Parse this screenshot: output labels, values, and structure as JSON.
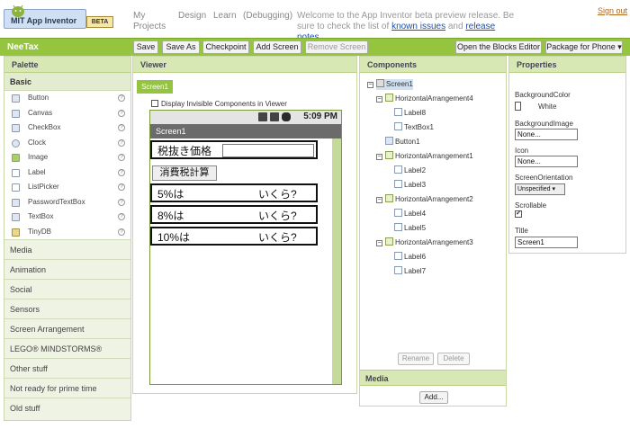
{
  "header": {
    "logo_text": "MIT App Inventor",
    "beta": "BETA",
    "nav": [
      "My Projects",
      "Design",
      "Learn",
      "(Debugging)"
    ],
    "welcome_text": "Welcome to the App Inventor beta preview release. Be sure to check the list of",
    "known_issues": "known issues",
    "and": "and",
    "release_notes": "release notes",
    "period": ".",
    "signout": "Sign out"
  },
  "toolbar": {
    "project_name": "NeeTax",
    "buttons": [
      "Save",
      "Save As",
      "Checkpoint",
      "Add Screen",
      "Remove Screen"
    ],
    "blocks_editor": "Open the Blocks Editor",
    "package": "Package for Phone ▾"
  },
  "palette": {
    "title": "Palette",
    "category_basic": "Basic",
    "items": [
      "Button",
      "Canvas",
      "CheckBox",
      "Clock",
      "Image",
      "Label",
      "ListPicker",
      "PasswordTextBox",
      "TextBox",
      "TinyDB"
    ],
    "categories": [
      "Media",
      "Animation",
      "Social",
      "Sensors",
      "Screen Arrangement",
      "LEGO® MINDSTORMS®",
      "Other stuff",
      "Not ready for prime time",
      "Old stuff"
    ]
  },
  "viewer": {
    "title": "Viewer",
    "screen_tab": "Screen1",
    "checkbox_label": "Display Invisible Components in Viewer",
    "time": "5:09 PM",
    "screen_title": "Screen1",
    "row1_label": "税抜き価格",
    "button": "消費税計算",
    "rows": [
      {
        "left": "5%は",
        "right": "いくら?"
      },
      {
        "left": "8%は",
        "right": "いくら?"
      },
      {
        "left": "10%は",
        "right": "いくら?"
      }
    ]
  },
  "components": {
    "title": "Components",
    "tree": {
      "screen": "Screen1",
      "ha4": "HorizontalArrangement4",
      "label8": "Label8",
      "textbox1": "TextBox1",
      "button1": "Button1",
      "ha1": "HorizontalArrangement1",
      "label2": "Label2",
      "label3": "Label3",
      "ha2": "HorizontalArrangement2",
      "label4": "Label4",
      "label5": "Label5",
      "ha3": "HorizontalArrangement3",
      "label6": "Label6",
      "label7": "Label7"
    },
    "rename": "Rename",
    "delete": "Delete",
    "media_title": "Media",
    "add": "Add..."
  },
  "properties": {
    "title": "Properties",
    "bg_color_label": "BackgroundColor",
    "bg_color_value": "White",
    "bg_image_label": "BackgroundImage",
    "bg_image_value": "None...",
    "icon_label": "Icon",
    "icon_value": "None...",
    "orientation_label": "ScreenOrientation",
    "orientation_value": "Unspecified",
    "scrollable_label": "Scrollable",
    "scrollable_check": "✔",
    "title_label": "Title",
    "title_value": "Screen1"
  },
  "colors": {
    "toolbar_green": "#95c43f",
    "panel_header": "#d8e8b4",
    "link_blue": "#1a4fb0"
  }
}
